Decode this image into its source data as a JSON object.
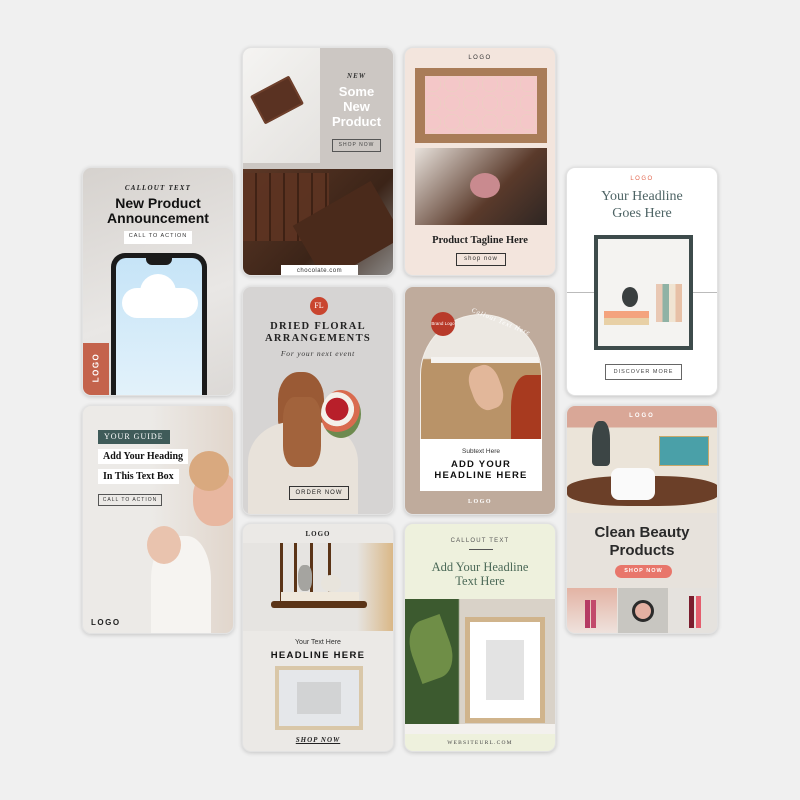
{
  "cards": {
    "phone": {
      "callout": "CALLOUT TEXT",
      "headline1": "New Product",
      "headline2": "Announcement",
      "cta": "CALL TO ACTION",
      "logo": "LOGO",
      "accent": "#c4634c"
    },
    "guide": {
      "tag": "YOUR GUIDE",
      "line1": "Add Your Heading",
      "line2": "In This Text Box",
      "cta": "CALL TO ACTION",
      "logo": "LOGO",
      "accent": "#3f5b59"
    },
    "chocolate": {
      "kicker": "NEW",
      "title1": "Some",
      "title2": "New",
      "title3": "Product",
      "cta": "SHOP NOW",
      "url": "chocolate.com"
    },
    "floral": {
      "monogram": "FL",
      "title1": "DRIED FLORAL",
      "title2": "ARRANGEMENTS",
      "subtitle": "For your next event",
      "cta": "ORDER NOW",
      "accent": "#c9452f"
    },
    "chair": {
      "logo": "LOGO",
      "subtext": "Your Text Here",
      "headline": "HEADLINE HERE",
      "cta": "SHOP NOW"
    },
    "cupcake": {
      "logo": "LOGO",
      "tagline": "Product Tagline Here",
      "cta": "shop now"
    },
    "arch": {
      "badge": "Brand Logo",
      "callout": "Callout Text Here",
      "subtext": "Subtext Here",
      "headline1": "ADD YOUR",
      "headline2": "HEADLINE HERE",
      "logo": "LOGO"
    },
    "plant": {
      "callout": "CALLOUT TEXT",
      "headline1": "Add Your Headline",
      "headline2": "Text Here",
      "url": "WEBSITEURL.COM"
    },
    "books": {
      "logo": "LOGO",
      "headline1": "Your Headline",
      "headline2": "Goes Here",
      "cta": "DISCOVER MORE",
      "accent": "#e2674f"
    },
    "beauty": {
      "logo": "LOGO",
      "title1": "Clean Beauty",
      "title2": "Products",
      "cta": "SHOP NOW",
      "accent": "#e8766b"
    }
  }
}
